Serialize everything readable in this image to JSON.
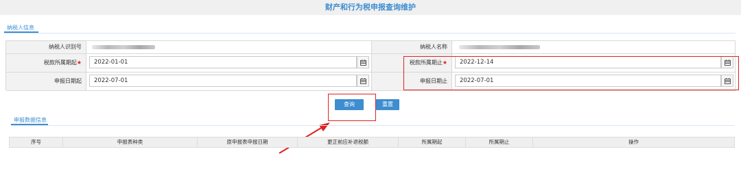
{
  "page": {
    "title": "财产和行为税申报查询维护"
  },
  "taxpayer_tab": {
    "label": "纳税人信息"
  },
  "form": {
    "taxpayer_id_label": "纳税人识别号",
    "taxpayer_name_label": "纳税人名称",
    "period_start_label": "税款所属期起",
    "period_end_label": "税款所属期止",
    "declare_start_label": "申报日期起",
    "declare_end_label": "申报日期止",
    "required_mark": "★",
    "period_start_value": "2022-01-01",
    "period_end_value": "2022-12-14",
    "declare_start_value": "2022-07-01",
    "declare_end_value": "2022-07-01"
  },
  "actions": {
    "query_label": "查询",
    "reset_label": "重置"
  },
  "data_tab": {
    "label": "申报数据信息"
  },
  "table": {
    "columns": [
      "序号",
      "申报表种类",
      "原申报表申报日期",
      "更正前应补退税额",
      "所属期起",
      "所属期止",
      "操作"
    ]
  },
  "colors": {
    "accent": "#3d8dd0",
    "highlight": "#e02020",
    "required": "#e02020"
  },
  "icons": {
    "calendar": "calendar-icon"
  }
}
